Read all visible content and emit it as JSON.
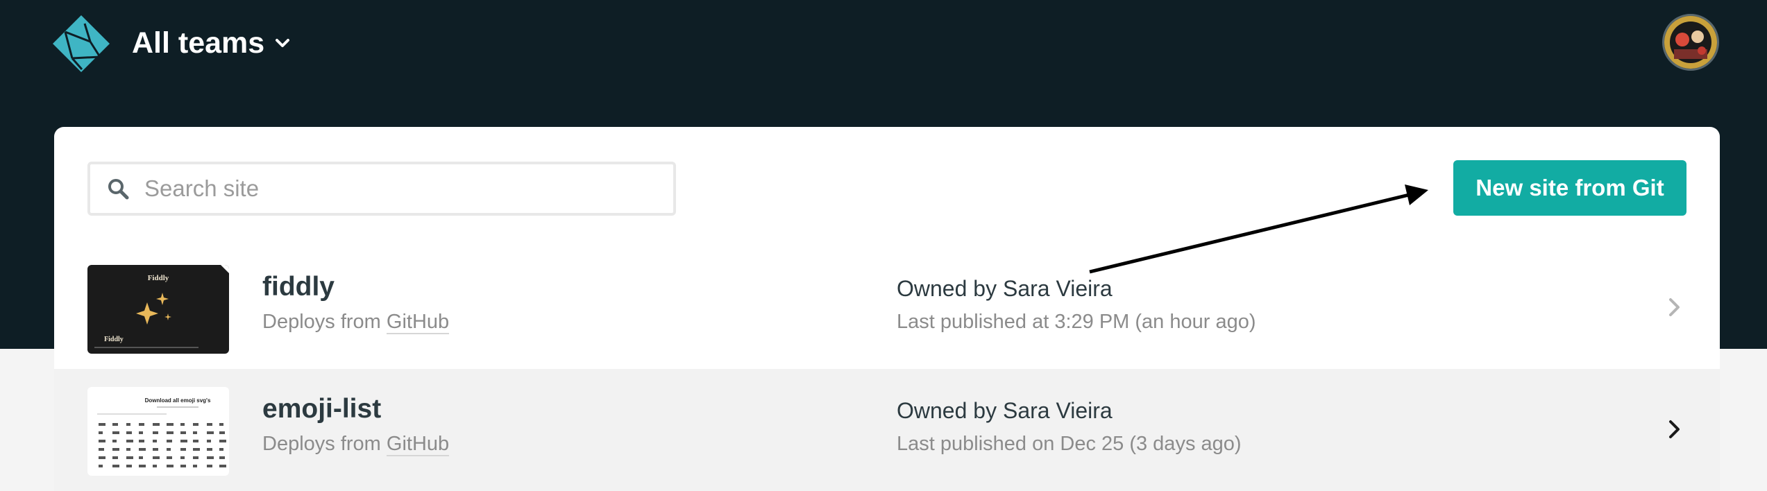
{
  "header": {
    "logo_icon": "netlify-logo-icon",
    "team_label": "All teams",
    "team_chevron_icon": "chevron-down-icon",
    "avatar_icon": "user-avatar"
  },
  "toolbar": {
    "search_placeholder": "Search site",
    "search_icon": "search-icon",
    "new_site_label": "New site from Git"
  },
  "sites": [
    {
      "name": "fiddly",
      "deploy_prefix": "Deploys from",
      "deploy_source": "GitHub",
      "owner_prefix": "Owned by",
      "owner_name": "Sara Vieira",
      "published": "Last published at 3:29 PM (an hour ago)",
      "thumb_title": "Fiddly",
      "thumb_caption": "Fiddly"
    },
    {
      "name": "emoji-list",
      "deploy_prefix": "Deploys from",
      "deploy_source": "GitHub",
      "owner_prefix": "Owned by",
      "owner_name": "Sara Vieira",
      "published": "Last published on Dec 25 (3 days ago)",
      "thumb_title": "Download all emoji svg's"
    }
  ],
  "colors": {
    "header_bg": "#0e1e25",
    "accent": "#12aca3",
    "logo": "#3fb5c4"
  }
}
